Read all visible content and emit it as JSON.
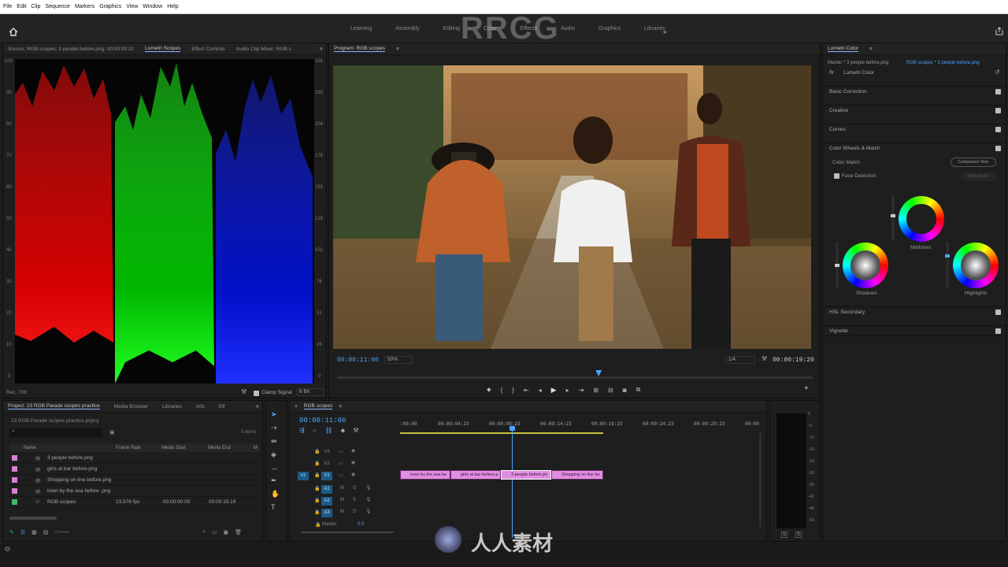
{
  "menu": [
    "File",
    "Edit",
    "Clip",
    "Sequence",
    "Markers",
    "Graphics",
    "View",
    "Window",
    "Help"
  ],
  "workspaces": [
    "Learning",
    "Assembly",
    "Editing",
    "Color",
    "Effects",
    "Audio",
    "Graphics",
    "Libraries"
  ],
  "watermark": "RRCG",
  "scopes_panel": {
    "tabs": [
      "Source: RGB scopes: 3 people before.png: 00:00:09:22",
      "Lumetri Scopes",
      "Effect Controls",
      "Audio Clip Mixer: RGB s"
    ],
    "left_scale": [
      "100",
      "90",
      "80",
      "70",
      "60",
      "50",
      "40",
      "30",
      "20",
      "10",
      "0"
    ],
    "right_scale": [
      "255",
      "230",
      "204",
      "178",
      "153",
      "128",
      "102",
      "76",
      "51",
      "26",
      "0"
    ],
    "rec": "Rec. 709",
    "clamp_label": "Clamp Signal",
    "bit_depth": "8 Bit"
  },
  "program": {
    "title": "Program: RGB scopes",
    "timecode": "00:00:11:00",
    "zoom": "50%",
    "resolution": "1/4",
    "duration": "00:00:19:20",
    "playhead_fraction": 0.55
  },
  "lumetri": {
    "title": "Lumetri Color",
    "master": "Master * 3 people before.png",
    "clip": "RGB scopes * 3 people before.png",
    "effect": "Lumetri Color",
    "sections": [
      "Basic Correction",
      "Creative",
      "Curves",
      "Color Wheels & Match"
    ],
    "color_match": "Color Match",
    "comparison_btn": "Comparison View",
    "face_detection": "Face Detection",
    "apply_match": "Apply Match",
    "wheels": [
      "Midtones",
      "Shadows",
      "Highlights"
    ],
    "sections2": [
      "HSL Secondary",
      "Vignette"
    ]
  },
  "project": {
    "tabs": [
      "Project: 23 RGB Parade scopes practice",
      "Media Browser",
      "Libraries",
      "Info",
      "Eff"
    ],
    "file": "23 RGB Parade scopes practice.prproj",
    "count": "5 items",
    "columns": [
      "Name",
      "Frame Rate",
      "Media Start",
      "Media End",
      "M"
    ],
    "items": [
      {
        "name": "3 people before.png",
        "color": "#d680d6",
        "fps": "",
        "start": "",
        "end": ""
      },
      {
        "name": "girls at bar before.png",
        "color": "#d680d6",
        "fps": "",
        "start": "",
        "end": ""
      },
      {
        "name": "Shopping on line before.png",
        "color": "#d680d6",
        "fps": "",
        "start": "",
        "end": ""
      },
      {
        "name": "town by the sea before .png",
        "color": "#d680d6",
        "fps": "",
        "start": "",
        "end": ""
      },
      {
        "name": "RGB scopes",
        "color": "#3fb86a",
        "fps": "23.976 fps",
        "start": "00:00:00:00",
        "end": "00:00:19:19"
      }
    ]
  },
  "timeline": {
    "title": "RGB scopes",
    "timecode": "00:00:11:00",
    "ruler": [
      ":00:00",
      "00:00:04:23",
      "00:00:09:23",
      "00:00:14:23",
      "00:00:19:23",
      "00:00:24:23",
      "00:00:29:23",
      "00:00"
    ],
    "video_tracks": [
      "V3",
      "V2",
      "V1"
    ],
    "audio_tracks": [
      "A1",
      "A2",
      "A3"
    ],
    "master": "Master",
    "master_val": "0.0",
    "clips": [
      "town by the sea be",
      "girls at bar before.p",
      "3 people before.pn",
      "Shopping on line be"
    ]
  },
  "audio_meter": {
    "scale": [
      "0",
      "-6",
      "-12",
      "-18",
      "-24",
      "-30",
      "-36",
      "-42",
      "-48",
      "-54"
    ],
    "s_buttons": [
      "S",
      "S"
    ]
  },
  "bottom_watermark": "人人素材"
}
